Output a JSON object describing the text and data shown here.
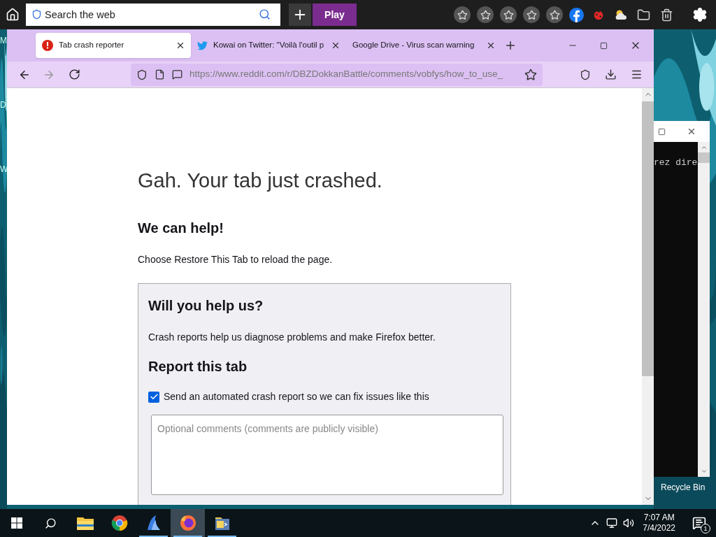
{
  "top_bar": {
    "search": {
      "placeholder": "Search the web"
    },
    "play_button": "Play"
  },
  "desktop": {
    "left_labels": [
      "M",
      "D",
      "W"
    ],
    "console_text": "rez dire",
    "recycle_bin": "Recycle Bin"
  },
  "browser": {
    "tabs": [
      {
        "title": "Tab crash reporter",
        "kind": "alert",
        "selected": true
      },
      {
        "title": "Kowai on Twitter: \"Voilà l'outil p",
        "kind": "bird",
        "selected": false
      },
      {
        "title": "Google Drive - Virus scan warning",
        "kind": "plain",
        "selected": false
      }
    ],
    "url": "https://www.reddit.com/r/DBZDokkanBattle/comments/vobfys/how_to_use_",
    "page": {
      "title": "Gah. Your tab just crashed.",
      "help_heading": "We can help!",
      "help_text": "Choose Restore This Tab to reload the page.",
      "report": {
        "heading": "Will you help us?",
        "text": "Crash reports help us diagnose problems and make Firefox better.",
        "subheading": "Report this tab",
        "checkbox": {
          "label": "Send an automated crash report so we can fix issues like this",
          "checked": true
        },
        "comments": {
          "placeholder": "Optional comments (comments are publicly visible)"
        }
      }
    }
  },
  "taskbar": {
    "apps": [
      {
        "kind": "explorer",
        "running": false,
        "selected": false
      },
      {
        "kind": "chrome",
        "running": false,
        "selected": false
      },
      {
        "kind": "shark",
        "running": true,
        "selected": false
      },
      {
        "kind": "firefox",
        "running": true,
        "selected": true
      },
      {
        "kind": "console",
        "running": true,
        "selected": false
      }
    ],
    "time": "7:07 AM",
    "date": "7/4/2022",
    "notifications": "1"
  }
}
